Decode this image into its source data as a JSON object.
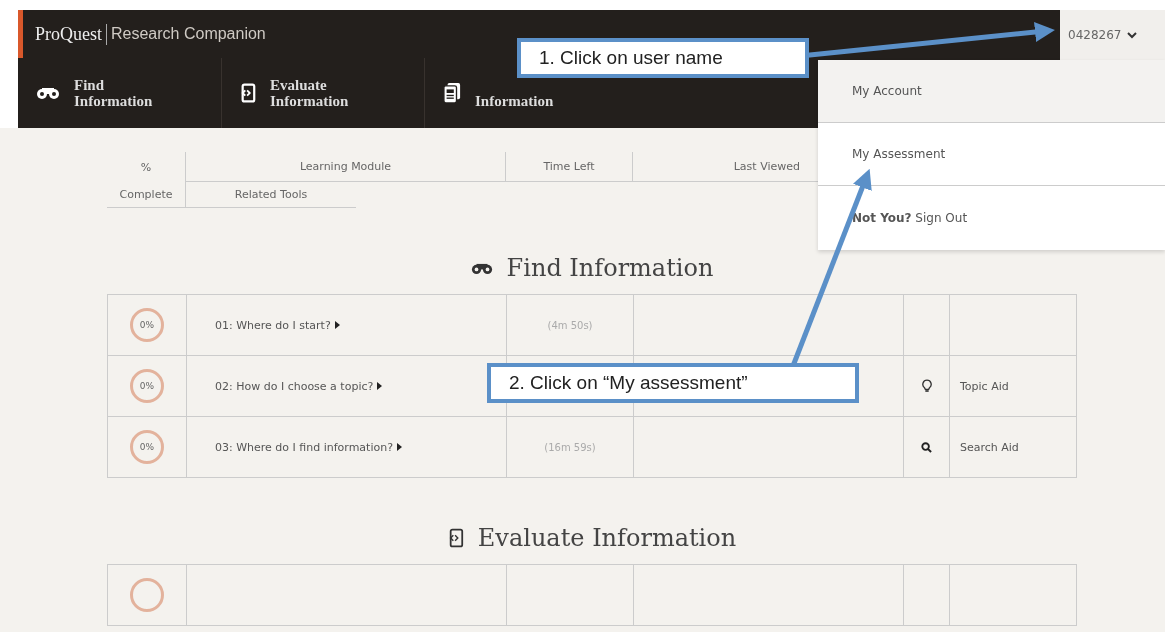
{
  "header": {
    "brand": "ProQuest",
    "product": "Research Companion",
    "user": "0428267"
  },
  "nav": [
    {
      "label": [
        "Find",
        "Information"
      ]
    },
    {
      "label": [
        "Evaluate",
        "Information"
      ]
    },
    {
      "label": [
        "Information"
      ]
    }
  ],
  "user_menu": [
    {
      "kind": "link",
      "label": "My Account",
      "selected": true
    },
    {
      "kind": "link",
      "label": "My Assessment",
      "selected": false
    },
    {
      "kind": "signout",
      "label": "**Not You?** Sign Out",
      "selected": false
    }
  ],
  "columns": {
    "row_1": [
      "%",
      "Learning Module",
      "Time Left",
      "Last Viewed"
    ],
    "row_2": [
      "Complete",
      "Related Tools"
    ]
  },
  "sections": [
    {
      "title": "Find Information",
      "partial": false,
      "rows": [
        {
          "progress": "0%",
          "module": "01: Where do I start?",
          "time": "(4m 50s)"
        },
        {
          "progress": "0%",
          "module": "02: How do I choose a topic?",
          "tool": "Topic Aid"
        },
        {
          "progress": "0%",
          "module": "03: Where do I find information?",
          "time": "(16m 59s)",
          "tool": "Search Aid"
        }
      ]
    },
    {
      "title": "Evaluate Information",
      "partial": true
    }
  ],
  "callouts": [
    "1. Click on user name",
    "2. Click on “My assessment”"
  ]
}
